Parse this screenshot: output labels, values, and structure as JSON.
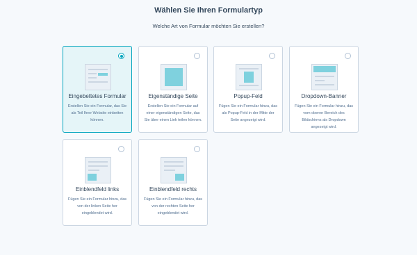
{
  "header": {
    "title": "Wählen Sie Ihren Formulartyp",
    "subtitle": "Welche Art von Formular möchten Sie erstellen?"
  },
  "form_types": [
    {
      "title": "Eingebettetes Formular",
      "description": "Erstellen Sie ein Formular, das Sie als Teil Ihrer Website einbetten können.",
      "selected": true
    },
    {
      "title": "Eigenständige Seite",
      "description": "Erstellen Sie ein Formular auf einer eigenständigen Seite, das Sie über einen Link teilen können.",
      "selected": false
    },
    {
      "title": "Popup-Feld",
      "description": "Fügen Sie ein Formular hinzu, das als Popup-Feld in der Mitte der Seite angezeigt wird.",
      "selected": false
    },
    {
      "title": "Dropdown-Banner",
      "description": "Fügen Sie ein Formular hinzu, das vom oberen Bereich des Bildschirms als Dropdown angezeigt wird.",
      "selected": false
    },
    {
      "title": "Einblendfeld links",
      "description": "Fügen Sie ein Formular hinzu, das von der linken Seite her eingeblendet wird.",
      "selected": false
    },
    {
      "title": "Einblendfeld rechts",
      "description": "Fügen Sie ein Formular hinzu, das von der rechten Seite her eingeblendet wird.",
      "selected": false
    }
  ],
  "colors": {
    "accent": "#00a4bd",
    "selected_background": "#e5f5f8",
    "thumbnail_accent": "#7fd1de"
  }
}
